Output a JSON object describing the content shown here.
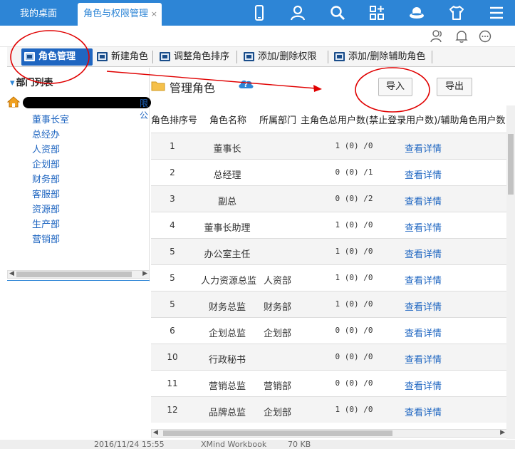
{
  "tabs": [
    {
      "label": "我的桌面"
    },
    {
      "label": "角色与权限管理",
      "close": "×"
    }
  ],
  "top_icons": [
    "phone-icon",
    "user-icon",
    "search-icon",
    "apps-icon",
    "hat-icon",
    "shirt-icon",
    "menu-icon"
  ],
  "second_icons": [
    "contacts-icon",
    "bell-icon",
    "chat-icon"
  ],
  "toolbar": {
    "role_manage": "角色管理",
    "new_role": "新建角色",
    "adjust_order": "调整角色排序",
    "add_remove_perm": "添加/删除权限",
    "add_remove_assist": "添加/删除辅助角色"
  },
  "dept_panel": {
    "header": "部门列表",
    "root_suffix": "限公",
    "departments": [
      "董事长室",
      "总经办",
      "人资部",
      "企划部",
      "财务部",
      "客服部",
      "资源部",
      "生产部",
      "营销部"
    ]
  },
  "main": {
    "title": "管理角色",
    "import": "导入",
    "export": "导出"
  },
  "table": {
    "headers": [
      "角色排序号",
      "角色名称",
      "所属部门",
      "主角色总用户数(禁止登录用户数)/辅助角色用户数"
    ],
    "rows": [
      {
        "order": "1",
        "name": "董事长",
        "dept": "",
        "count": "1 (0) /0",
        "link": "查看详情"
      },
      {
        "order": "2",
        "name": "总经理",
        "dept": "",
        "count": "0 (0) /1",
        "link": "查看详情"
      },
      {
        "order": "3",
        "name": "副总",
        "dept": "",
        "count": "0 (0) /2",
        "link": "查看详情"
      },
      {
        "order": "4",
        "name": "董事长助理",
        "dept": "",
        "count": "1 (0) /0",
        "link": "查看详情"
      },
      {
        "order": "5",
        "name": "办公室主任",
        "dept": "",
        "count": "1 (0) /0",
        "link": "查看详情"
      },
      {
        "order": "5",
        "name": "人力资源总监",
        "dept": "人资部",
        "count": "1 (0) /0",
        "link": "查看详情"
      },
      {
        "order": "5",
        "name": "财务总监",
        "dept": "财务部",
        "count": "1 (0) /0",
        "link": "查看详情"
      },
      {
        "order": "6",
        "name": "企划总监",
        "dept": "企划部",
        "count": "0 (0) /0",
        "link": "查看详情"
      },
      {
        "order": "10",
        "name": "行政秘书",
        "dept": "",
        "count": "0 (0) /0",
        "link": "查看详情"
      },
      {
        "order": "11",
        "name": "营销总监",
        "dept": "营销部",
        "count": "0 (0) /0",
        "link": "查看详情"
      },
      {
        "order": "12",
        "name": "品牌总监",
        "dept": "企划部",
        "count": "1 (0) /0",
        "link": "查看详情"
      }
    ]
  },
  "bottom_strip": {
    "date": "2016/11/24 15:55",
    "type": "XMind Workbook",
    "size": "70 KB"
  },
  "colors": {
    "topbar": "#2d85d6",
    "toolbar_active": "#1f66c1",
    "link": "#1f66c1",
    "annotation": "#e00000"
  }
}
